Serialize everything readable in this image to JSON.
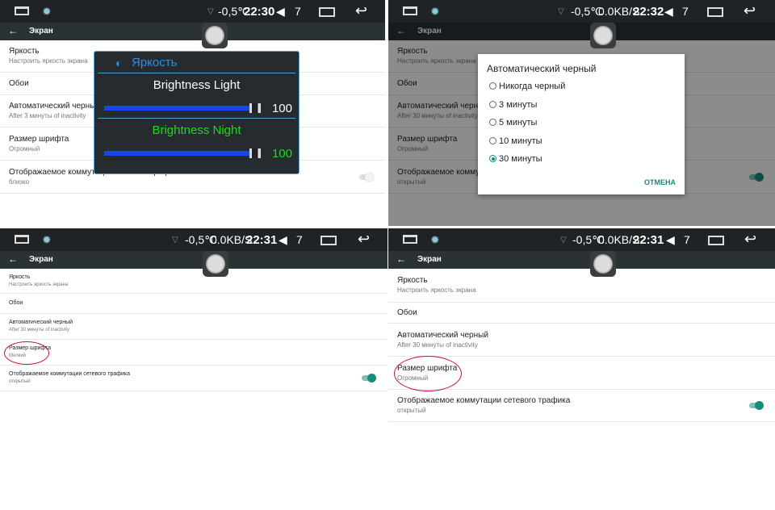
{
  "colors": {
    "status_bg": "#1f2326",
    "title_bg": "#2b3236",
    "accent": "#168c7c",
    "brightness_bar": "#1846e8",
    "night_green": "#22d622",
    "highlight_ellipse": "#c8102e"
  },
  "panels": [
    {
      "status": {
        "temp": "-0,5℃",
        "speed": "",
        "time": "22:30",
        "volume": "7"
      },
      "title": "Экран",
      "rows": [
        {
          "title": "Яркость",
          "sub": "Настроить яркость экрана"
        },
        {
          "title": "Обои",
          "sub": ""
        },
        {
          "title": "Автоматический черный",
          "sub": "After 3 минуты of inactivity"
        },
        {
          "title": "Размер шрифта",
          "sub": "Огромный"
        },
        {
          "title": "Отображаемое коммутации сетевого трафика",
          "sub": "близко",
          "toggle": "off"
        }
      ],
      "brightness_popup": {
        "header": "Яркость",
        "light_label": "Brightness Light",
        "light_value": "100",
        "night_label": "Brightness Night",
        "night_value": "100"
      }
    },
    {
      "status": {
        "temp": "-0,5℃",
        "speed": "0.0KB/S",
        "time": "22:32",
        "volume": "7"
      },
      "title": "Экран",
      "rows": [
        {
          "title": "Яркость",
          "sub": "Настроить яркость экрана"
        },
        {
          "title": "Обои",
          "sub": ""
        },
        {
          "title": "Автоматический черный",
          "sub": "After 30 минуты of inactivity"
        },
        {
          "title": "Размер шрифта",
          "sub": "Огромный"
        },
        {
          "title": "Отображаемое коммутации сетевого трафика",
          "sub": "открытый",
          "toggle": "on"
        }
      ],
      "dialog": {
        "title": "Автоматический черный",
        "options": [
          "Никогда черный",
          "3 минуты",
          "5 минуты",
          "10 минуты",
          "30 минуты"
        ],
        "selected": "30 минуты",
        "cancel": "ОТМЕНА"
      }
    },
    {
      "status": {
        "temp": "-0,5℃",
        "speed": "0.0KB/S",
        "time": "22:31",
        "volume": "7"
      },
      "title": "Экран",
      "rows": [
        {
          "title": "Яркость",
          "sub": "Настроить яркость экрана"
        },
        {
          "title": "Обои",
          "sub": ""
        },
        {
          "title": "Автоматический черный",
          "sub": "After 30 минуты of inactivity"
        },
        {
          "title": "Размер шрифта",
          "sub": "Мелкий"
        },
        {
          "title": "Отображаемое коммутации сетевого трафика",
          "sub": "открытый",
          "toggle": "on"
        }
      ]
    },
    {
      "status": {
        "temp": "-0,5℃",
        "speed": "0.0KB/S",
        "time": "22:31",
        "volume": "7"
      },
      "title": "Экран",
      "rows": [
        {
          "title": "Яркость",
          "sub": "Настроить яркость экрана"
        },
        {
          "title": "Обои",
          "sub": ""
        },
        {
          "title": "Автоматический черный",
          "sub": "After 30 минуты of inactivity"
        },
        {
          "title": "Размер шрифта",
          "sub": "Огромный"
        },
        {
          "title": "Отображаемое коммутации сетевого трафика",
          "sub": "открытый",
          "toggle": "on"
        }
      ]
    }
  ]
}
